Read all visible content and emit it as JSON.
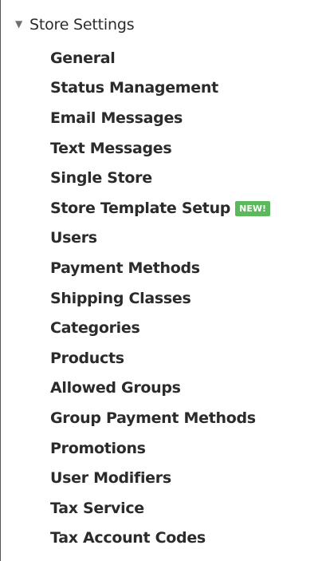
{
  "section": {
    "arrow_glyph": "▼",
    "title": "Store Settings"
  },
  "menu": {
    "items": [
      {
        "label": "General"
      },
      {
        "label": "Status Management"
      },
      {
        "label": "Email Messages"
      },
      {
        "label": "Text Messages"
      },
      {
        "label": "Single Store"
      },
      {
        "label": "Store Template Setup",
        "badge": "NEW!"
      },
      {
        "label": "Users"
      },
      {
        "label": "Payment Methods"
      },
      {
        "label": "Shipping Classes"
      },
      {
        "label": "Categories"
      },
      {
        "label": "Products"
      },
      {
        "label": "Allowed Groups"
      },
      {
        "label": "Group Payment Methods"
      },
      {
        "label": "Promotions"
      },
      {
        "label": "User Modifiers"
      },
      {
        "label": "Tax Service"
      },
      {
        "label": "Tax Account Codes"
      }
    ]
  },
  "colors": {
    "badge_background": "#5cb85c",
    "text": "#2b2b2b",
    "arrow": "#707070",
    "border": "#555555"
  }
}
